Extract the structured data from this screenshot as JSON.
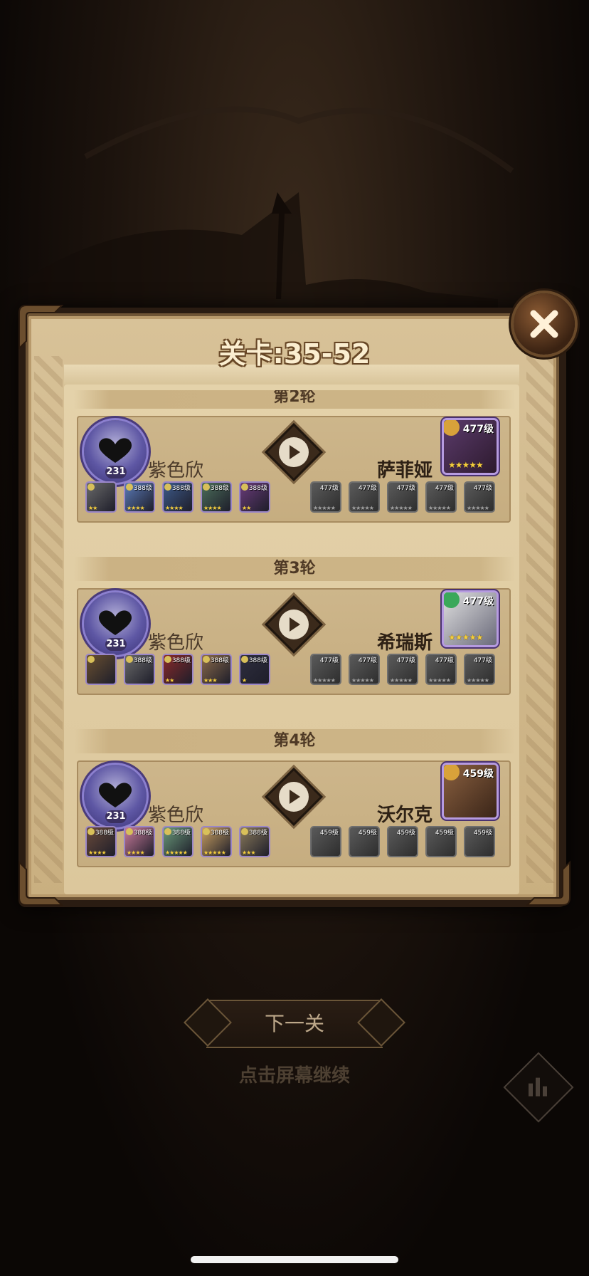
{
  "title": "关卡:35-52",
  "rounds": [
    {
      "label": "第2轮",
      "player": {
        "name": "紫色欣",
        "level": "231"
      },
      "player_team": [
        {
          "level": "",
          "stars": "★★",
          "color": "#6a6a6a"
        },
        {
          "level": "388级",
          "stars": "★★★★",
          "color": "#5a7ab8"
        },
        {
          "level": "388级",
          "stars": "★★★★",
          "color": "#3d5a8a"
        },
        {
          "level": "388级",
          "stars": "★★★★",
          "color": "#4b6e5a"
        },
        {
          "level": "388级",
          "stars": "★★",
          "color": "#6a3b7a"
        }
      ],
      "enemy": {
        "name": "萨菲娅",
        "level": "477级",
        "stars": "★★★★★",
        "faction_color": "#d8a23a",
        "portrait": "#8a2a3a"
      },
      "enemy_team": [
        {
          "level": "477级",
          "stars": "★★★★★"
        },
        {
          "level": "477级",
          "stars": "★★★★★"
        },
        {
          "level": "477级",
          "stars": "★★★★★"
        },
        {
          "level": "477级",
          "stars": "★★★★★"
        },
        {
          "level": "477级",
          "stars": "★★★★★"
        }
      ]
    },
    {
      "label": "第3轮",
      "player": {
        "name": "紫色欣",
        "level": "231"
      },
      "player_team": [
        {
          "level": "",
          "stars": "",
          "color": "#6a5030"
        },
        {
          "level": "388级",
          "stars": "",
          "color": "#6a6a6a"
        },
        {
          "level": "388级",
          "stars": "★★",
          "color": "#8a2a2a"
        },
        {
          "level": "388级",
          "stars": "★★★",
          "color": "#8a6a4a"
        },
        {
          "level": "388级",
          "stars": "★",
          "color": "#2e2e3e"
        }
      ],
      "enemy": {
        "name": "希瑞斯",
        "level": "477级",
        "stars": "★★★★★",
        "faction_color": "#3aa85a",
        "portrait": "#c9c9c9"
      },
      "enemy_team": [
        {
          "level": "477级",
          "stars": "★★★★★"
        },
        {
          "level": "477级",
          "stars": "★★★★★"
        },
        {
          "level": "477级",
          "stars": "★★★★★"
        },
        {
          "level": "477级",
          "stars": "★★★★★"
        },
        {
          "level": "477级",
          "stars": "★★★★★"
        }
      ]
    },
    {
      "label": "第4轮",
      "player": {
        "name": "紫色欣",
        "level": "231"
      },
      "player_team": [
        {
          "level": "388级",
          "stars": "★★★★",
          "color": "#6a4a3a"
        },
        {
          "level": "388级",
          "stars": "★★★★",
          "color": "#c97a9a"
        },
        {
          "level": "388级",
          "stars": "★★★★★",
          "color": "#6a9a7a"
        },
        {
          "level": "388级",
          "stars": "★★★★★",
          "color": "#caa060"
        },
        {
          "level": "388级",
          "stars": "★★★",
          "color": "#8a7a5a"
        }
      ],
      "enemy": {
        "name": "沃尔克",
        "level": "459级",
        "stars": "",
        "faction_color": "#d8a23a",
        "portrait": "#6a4a30"
      },
      "enemy_team": [
        {
          "level": "459级",
          "stars": ""
        },
        {
          "level": "459级",
          "stars": ""
        },
        {
          "level": "459级",
          "stars": ""
        },
        {
          "level": "459级",
          "stars": ""
        },
        {
          "level": "459级",
          "stars": ""
        }
      ]
    }
  ],
  "footer": {
    "next_label": "下一关",
    "hint": "点击屏幕继续"
  }
}
